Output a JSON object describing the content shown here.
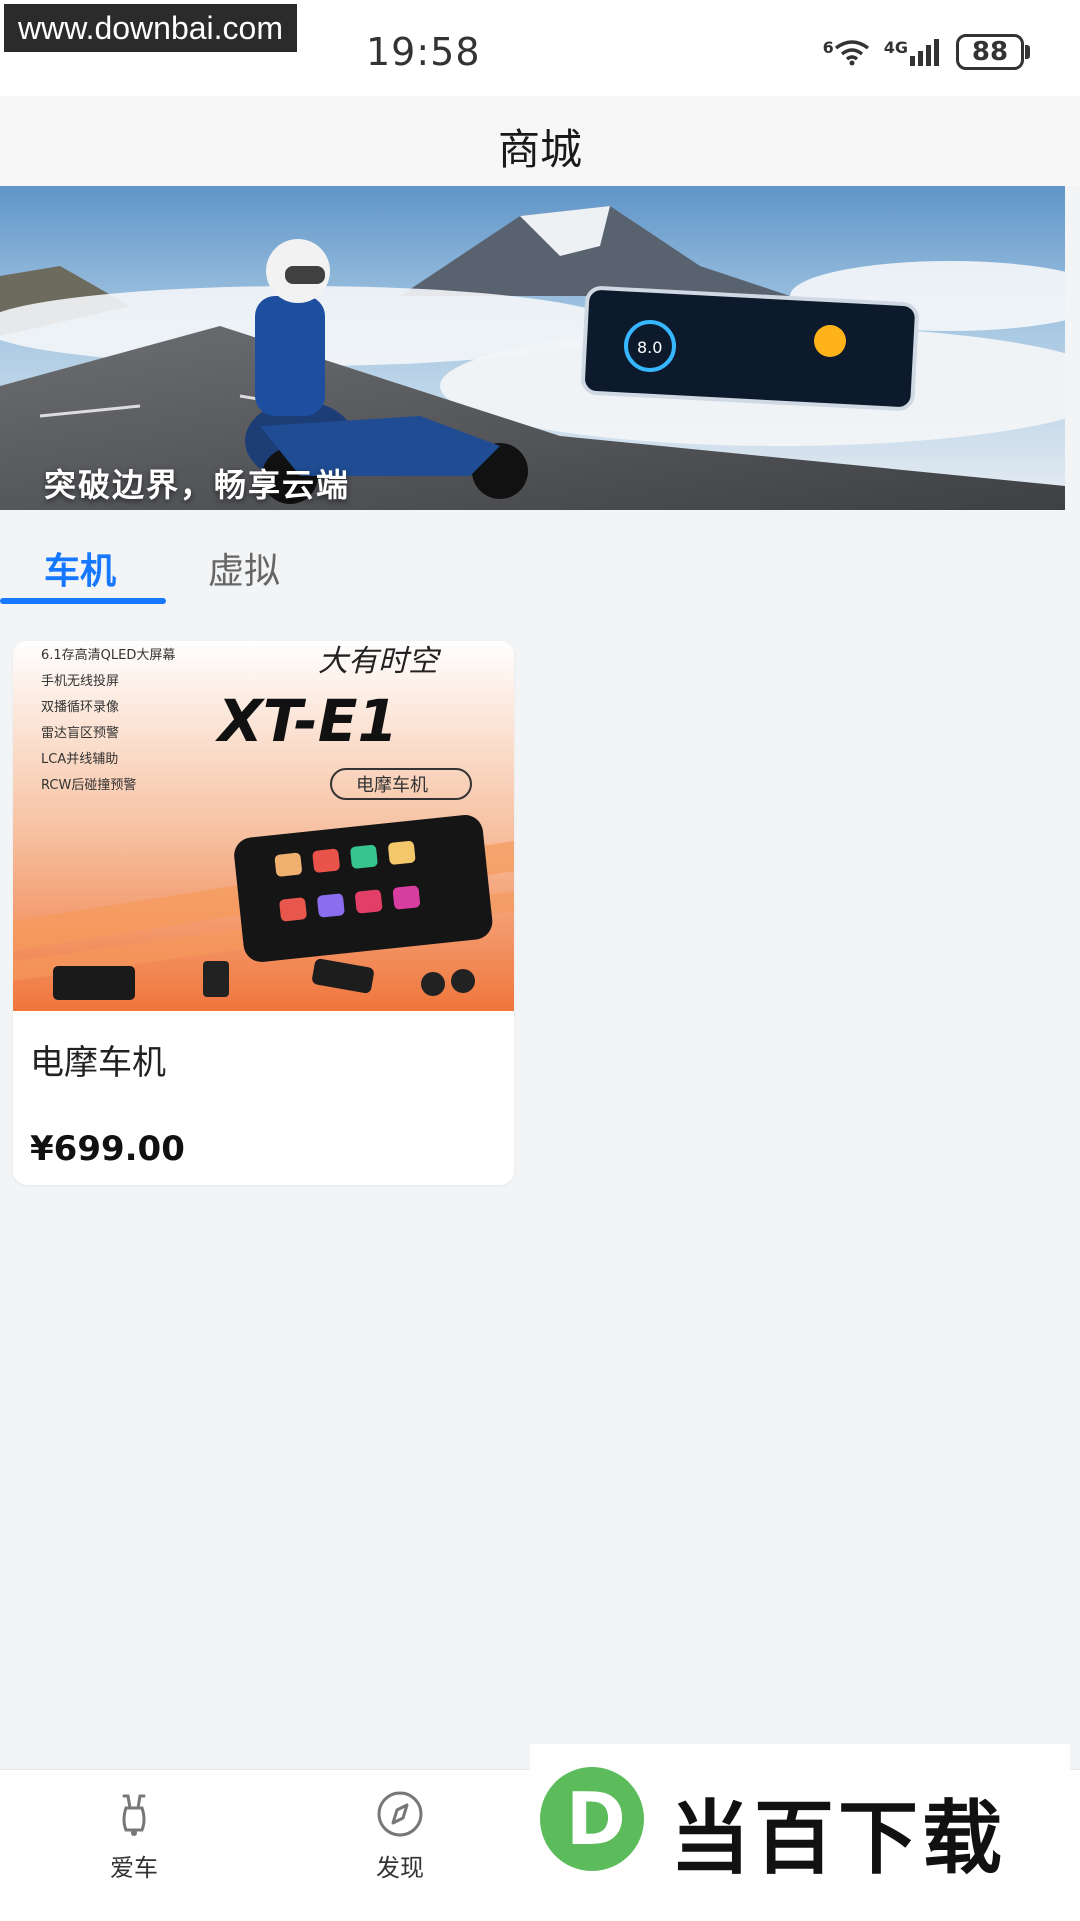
{
  "status_bar": {
    "watermark": "www.downbai.com",
    "time": "19:58",
    "wifi_badge": "6",
    "network": "4G",
    "battery": "88"
  },
  "header": {
    "title": "商城"
  },
  "banner": {
    "caption": "突破边界，畅享云端"
  },
  "tabs": [
    {
      "label": "车机",
      "active": true
    },
    {
      "label": "虚拟",
      "active": false
    }
  ],
  "product": {
    "title": "电摩车机",
    "price": "¥699.00",
    "image": {
      "features": [
        "6.1存高清QLED大屏幕",
        "手机无线投屏",
        "双播循环录像",
        "雷达盲区预警",
        "LCA并线辅助",
        "RCW后碰撞预警"
      ],
      "brand": "大有时空",
      "model": "XT-E1",
      "badge": "电摩车机"
    }
  },
  "bottom_nav": [
    {
      "label": "爱车",
      "icon": "scooter-icon"
    },
    {
      "label": "发现",
      "icon": "compass-icon"
    }
  ],
  "watermark_logo": {
    "text": "当百下载",
    "letter": "D"
  }
}
